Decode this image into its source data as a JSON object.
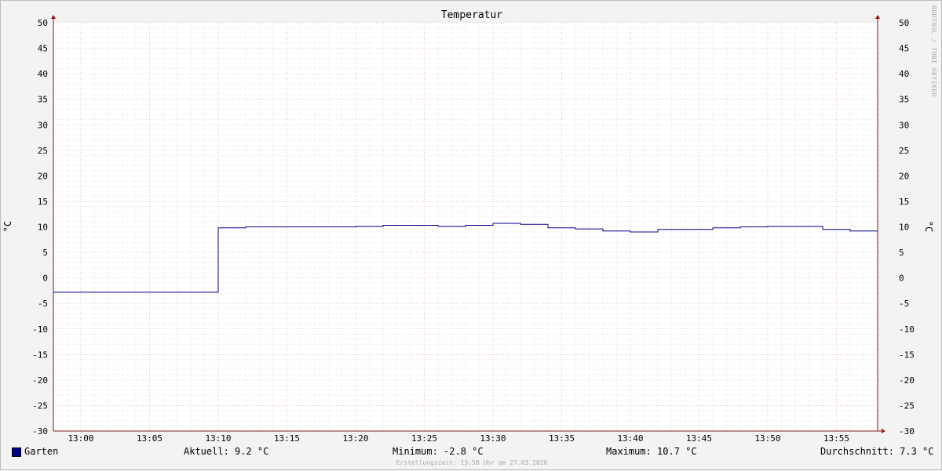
{
  "chart_data": {
    "type": "line",
    "title": "Temperatur",
    "ylabel": "°C",
    "ylim": [
      -30,
      50
    ],
    "yticks": [
      50,
      45,
      40,
      35,
      30,
      25,
      20,
      15,
      10,
      5,
      0,
      -5,
      -10,
      -15,
      -20,
      -25,
      -30
    ],
    "xticks": [
      "13:00",
      "13:05",
      "13:10",
      "13:15",
      "13:20",
      "13:25",
      "13:30",
      "13:35",
      "13:40",
      "13:45",
      "13:50",
      "13:55"
    ],
    "xlim_minutes": [
      -2,
      58
    ],
    "grid": true,
    "series": [
      {
        "name": "Garten",
        "color": "#00008b",
        "step": true,
        "points": [
          [
            -2,
            -2.8
          ],
          [
            10,
            9.8
          ],
          [
            12,
            10.0
          ],
          [
            14,
            10.0
          ],
          [
            16,
            10.0
          ],
          [
            18,
            10.0
          ],
          [
            20,
            10.1
          ],
          [
            22,
            10.3
          ],
          [
            24,
            10.3
          ],
          [
            26,
            10.1
          ],
          [
            28,
            10.3
          ],
          [
            30,
            10.7
          ],
          [
            32,
            10.5
          ],
          [
            34,
            9.8
          ],
          [
            36,
            9.6
          ],
          [
            38,
            9.2
          ],
          [
            40,
            9.0
          ],
          [
            42,
            9.5
          ],
          [
            44,
            9.5
          ],
          [
            46,
            9.8
          ],
          [
            48,
            10.0
          ],
          [
            50,
            10.1
          ],
          [
            52,
            10.1
          ],
          [
            54,
            9.5
          ],
          [
            56,
            9.2
          ],
          [
            58,
            9.2
          ]
        ]
      }
    ]
  },
  "watermark": "RRDTOOL / TOBI OETIKER",
  "legend": {
    "series_name": "Garten",
    "current": "Aktuell: 9.2 °C",
    "minimum": "Minimum: -2.8 °C",
    "maximum": "Maximum: 10.7 °C",
    "average": "Durchschnitt: 7.3 °C"
  },
  "footer": "Erstellungszeit: 13:58 Uhr am 27.03.2026"
}
